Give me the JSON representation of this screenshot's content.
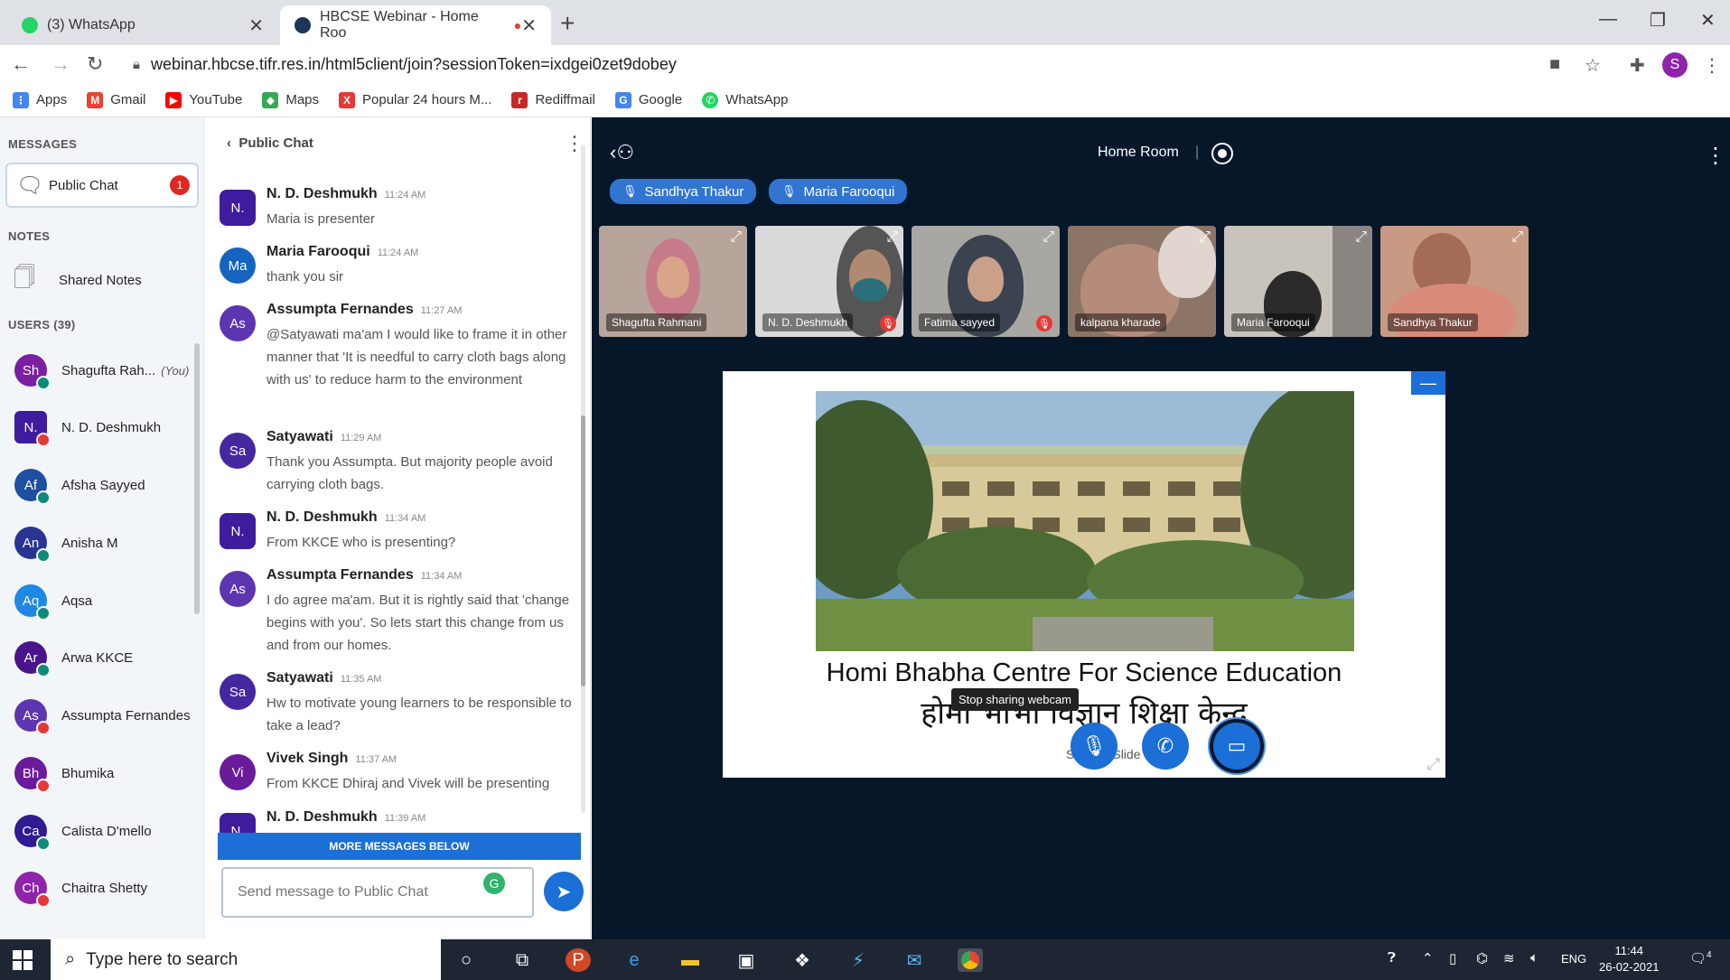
{
  "browser": {
    "tabs": [
      {
        "title": "(3) WhatsApp",
        "favicon_color": "#25d366"
      },
      {
        "title": "HBCSE Webinar - Home Roo",
        "favicon_color": "#1d3557"
      }
    ],
    "url": "webinar.hbcse.tifr.res.in/html5client/join?sessionToken=ixdgei0zet9dobey",
    "profile_initial": "S",
    "bookmarks": [
      {
        "label": "Apps",
        "color": "#4285f4",
        "icon": "apps-grid-icon"
      },
      {
        "label": "Gmail",
        "color": "#ea4335",
        "icon": "gmail-icon"
      },
      {
        "label": "YouTube",
        "color": "#ff0000",
        "icon": "youtube-icon"
      },
      {
        "label": "Maps",
        "color": "#34a853",
        "icon": "maps-icon"
      },
      {
        "label": "Popular 24 hours M...",
        "color": "#e53935",
        "icon": "x-icon"
      },
      {
        "label": "Rediffmail",
        "color": "#c62828",
        "icon": "rediff-icon"
      },
      {
        "label": "Google",
        "color": "#4285f4",
        "icon": "google-icon"
      },
      {
        "label": "WhatsApp",
        "color": "#25d366",
        "icon": "whatsapp-icon"
      }
    ]
  },
  "sidebar": {
    "messages_title": "MESSAGES",
    "public_chat": {
      "label": "Public Chat",
      "badge": "1"
    },
    "notes_title": "NOTES",
    "shared_notes": "Shared Notes",
    "users_title": "USERS (39)",
    "users": [
      {
        "initials": "Sh",
        "name": "Shagufta Rah...",
        "you": "(You)",
        "color": "#7b1fa2",
        "status": "#0d8a7a"
      },
      {
        "initials": "N.",
        "name": "N. D. Deshmukh",
        "color": "#3f1c9e",
        "status": "#e53935"
      },
      {
        "initials": "Af",
        "name": "Afsha Sayyed",
        "color": "#1e4fa0",
        "status": "#0d8a7a"
      },
      {
        "initials": "An",
        "name": "Anisha M",
        "color": "#283593",
        "status": "#0d8a7a"
      },
      {
        "initials": "Aq",
        "name": "Aqsa",
        "color": "#1e88e5",
        "status": "#0d8a7a"
      },
      {
        "initials": "Ar",
        "name": "Arwa KKCE",
        "color": "#4a148c",
        "status": "#0d8a7a"
      },
      {
        "initials": "As",
        "name": "Assumpta Fernandes",
        "color": "#5e35b1",
        "status": "#e53935"
      },
      {
        "initials": "Bh",
        "name": "Bhumika",
        "color": "#6a1b9a",
        "status": "#e53935"
      },
      {
        "initials": "Ca",
        "name": "Calista D'mello",
        "color": "#311b92",
        "status": "#0d8a7a"
      },
      {
        "initials": "Ch",
        "name": "Chaitra Shetty",
        "color": "#8e24aa",
        "status": "#e53935"
      }
    ]
  },
  "chat": {
    "header": "Public Chat",
    "messages": [
      {
        "initials": "N.",
        "name": "N. D. Deshmukh",
        "time": "11:24 AM",
        "text": "Maria is presenter",
        "color": "#3f1c9e"
      },
      {
        "initials": "Ma",
        "name": "Maria Farooqui",
        "time": "11:24 AM",
        "text": "thank you sir",
        "color": "#1565c0"
      },
      {
        "initials": "As",
        "name": "Assumpta Fernandes",
        "time": "11:27 AM",
        "text": "@Satyawati ma'am I would like to frame it in other manner that 'It is needful to carry cloth bags along with us' to reduce harm to the environment",
        "color": "#5e35b1"
      },
      {
        "initials": "Sa",
        "name": "Satyawati",
        "time": "11:29 AM",
        "text": "Thank you Assumpta. But majority people avoid carrying cloth bags.",
        "color": "#4527a0"
      },
      {
        "initials": "N.",
        "name": "N. D. Deshmukh",
        "time": "11:34 AM",
        "text": "From KKCE who is presenting?",
        "color": "#3f1c9e"
      },
      {
        "initials": "As",
        "name": "Assumpta Fernandes",
        "time": "11:34 AM",
        "text": "I do agree ma'am. But it is rightly said that 'change begins with you'. So lets start this change from us and from our homes.",
        "color": "#5e35b1"
      },
      {
        "initials": "Sa",
        "name": "Satyawati",
        "time": "11:35 AM",
        "text": "Hw to motivate young learners to be responsible to take a lead?",
        "color": "#4527a0"
      },
      {
        "initials": "Vi",
        "name": "Vivek Singh",
        "time": "11:37 AM",
        "text": "From KKCE Dhiraj and Vivek will be presenting",
        "color": "#6a1b9a"
      },
      {
        "initials": "N.",
        "name": "N. D. Deshmukh",
        "time": "11:39 AM",
        "text": "",
        "color": "#3f1c9e"
      }
    ],
    "more_messages": "MORE MESSAGES BELOW",
    "input_placeholder": "Send message to Public Chat"
  },
  "meeting": {
    "room": "Home Room",
    "talkers": [
      "Sandhya Thakur",
      "Maria Farooqui"
    ],
    "cams": [
      {
        "name": "Shagufta Rahmani",
        "bg": "#b7a49a",
        "face": "#c98a7b",
        "muted": false
      },
      {
        "name": "N. D. Deshmukh",
        "bg": "#d9d9d9",
        "face": "#2a6f7a",
        "muted": true
      },
      {
        "name": "Fatima sayyed",
        "bg": "#a9a7a2",
        "face": "#c19a8a",
        "muted": true
      },
      {
        "name": "kalpana kharade",
        "bg": "#8c7466",
        "face": "#b58b7a",
        "muted": false
      },
      {
        "name": "Maria Farooqui",
        "bg": "#c8c3bb",
        "face": "#2a2a2a",
        "muted": false
      },
      {
        "name": "Sandhya Thakur",
        "bg": "#c89a84",
        "face": "#a46b55",
        "muted": false
      }
    ],
    "slide": {
      "title": "Homi Bhabha Centre For Science Education",
      "subtitle": "होमी भाभा विज्ञान शिक्षा केन्द्र",
      "caption": "Sample Slide"
    },
    "tooltip": "Stop sharing webcam"
  },
  "taskbar": {
    "search_placeholder": "Type here to search",
    "lang": "ENG",
    "time": "11:44",
    "date": "26-02-2021",
    "notif_count": "4"
  }
}
